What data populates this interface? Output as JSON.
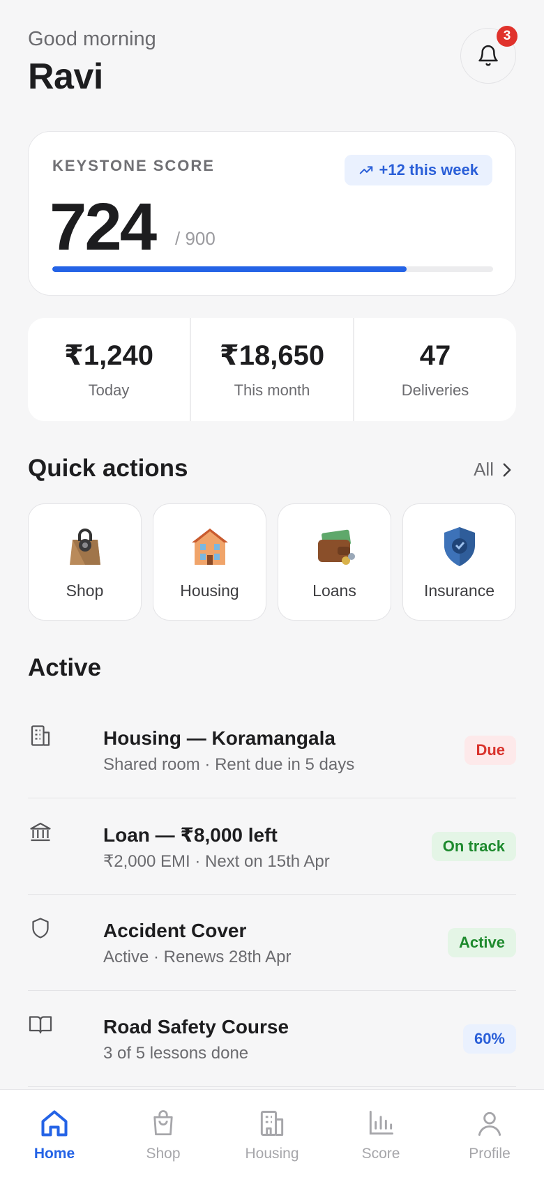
{
  "header": {
    "greeting": "Good morning",
    "name": "Ravi",
    "notification_count": "3"
  },
  "score": {
    "label": "KEYSTONE SCORE",
    "trend": "+12 this week",
    "value": "724",
    "max": "/ 900",
    "progress_fraction": 0.804
  },
  "stats": [
    {
      "value": "₹1,240",
      "label": "Today"
    },
    {
      "value": "₹18,650",
      "label": "This month"
    },
    {
      "value": "47",
      "label": "Deliveries"
    }
  ],
  "quick_actions": {
    "title": "Quick actions",
    "see_all": "All",
    "items": [
      {
        "label": "Shop",
        "icon": "shopping-bag-icon"
      },
      {
        "label": "Housing",
        "icon": "house-icon"
      },
      {
        "label": "Loans",
        "icon": "wallet-icon"
      },
      {
        "label": "Insurance",
        "icon": "shield-icon"
      }
    ]
  },
  "active": {
    "title": "Active",
    "items": [
      {
        "icon": "building-icon",
        "title": "Housing — Koramangala",
        "subtitle": "Shared room · Rent due in 5 days",
        "status": "Due",
        "status_color": "#d9332c"
      },
      {
        "icon": "bank-icon",
        "title": "Loan — ₹8,000 left",
        "subtitle": "₹2,000 EMI · Next on 15th Apr",
        "status": "On track",
        "status_color": "#1e8a2e"
      },
      {
        "icon": "shield-outline-icon",
        "title": "Accident Cover",
        "subtitle": "Active · Renews 28th Apr",
        "status": "Active",
        "status_color": "#1e8a2e"
      },
      {
        "icon": "book-icon",
        "title": "Road Safety Course",
        "subtitle": "3 of 5 lessons done",
        "status": "60%",
        "status_color": "#2a5fd8"
      }
    ]
  },
  "tabbar": {
    "active": "Home",
    "accent": "#2463e6",
    "tabs": [
      {
        "label": "Home",
        "icon": "home-icon"
      },
      {
        "label": "Shop",
        "icon": "bag-icon"
      },
      {
        "label": "Housing",
        "icon": "building-icon"
      },
      {
        "label": "Score",
        "icon": "bar-chart-icon"
      },
      {
        "label": "Profile",
        "icon": "person-icon"
      }
    ]
  }
}
